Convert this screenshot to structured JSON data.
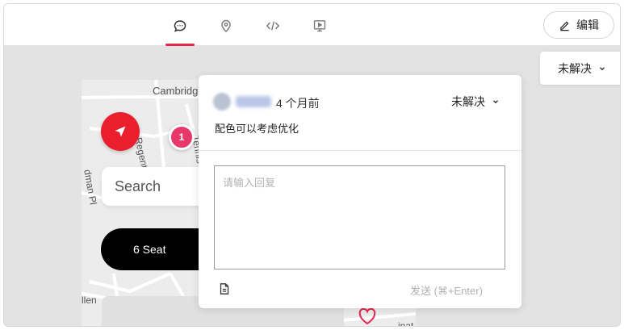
{
  "toolbar": {
    "tabs": [
      {
        "name": "comment",
        "icon": "comment-icon",
        "active": true
      },
      {
        "name": "location",
        "icon": "location-pin-icon",
        "active": false
      },
      {
        "name": "code",
        "icon": "code-icon",
        "active": false
      },
      {
        "name": "present",
        "icon": "presentation-icon",
        "active": false
      }
    ],
    "edit_label": "编辑",
    "accent_color": "#e8264a"
  },
  "status_filter": {
    "label": "未解决"
  },
  "canvas": {
    "street_labels": [
      "Cambridge",
      "Regent Pl",
      "Tennis",
      "dman Pl",
      "llen",
      "inat"
    ],
    "pin_number": "1",
    "search_placeholder": "Search",
    "seat_label": "6 Seat",
    "brand_color": "#ea1e2d"
  },
  "comment": {
    "time": "4 个月前",
    "status": "未解决",
    "text": "配色可以考虑优化",
    "reply_placeholder": "请输入回复",
    "send_label": "发送 (⌘+Enter)"
  }
}
